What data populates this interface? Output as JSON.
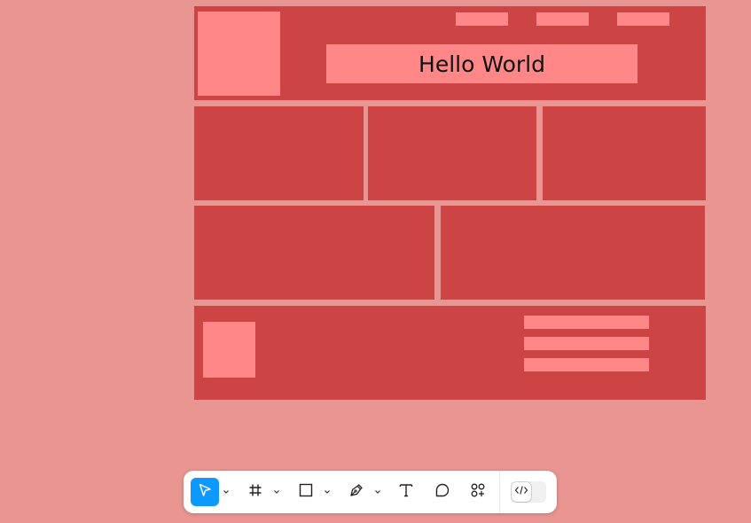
{
  "canvas": {
    "background": "#e99591",
    "block_color": "#cc4444",
    "accent_color": "#ff8787"
  },
  "header": {
    "title": "Hello World"
  },
  "toolbar": {
    "active_color": "#0d99ff",
    "tools": [
      {
        "name": "move-tool",
        "icon": "cursor-arrow-icon",
        "active": true,
        "has_menu": true
      },
      {
        "name": "frame-tool",
        "icon": "frame-hash-icon",
        "active": false,
        "has_menu": true
      },
      {
        "name": "shape-tool",
        "icon": "rectangle-icon",
        "active": false,
        "has_menu": true
      },
      {
        "name": "pen-tool",
        "icon": "pen-nib-icon",
        "active": false,
        "has_menu": true
      },
      {
        "name": "text-tool",
        "icon": "text-t-icon",
        "active": false,
        "has_menu": false
      },
      {
        "name": "comment-tool",
        "icon": "speech-bubble-icon",
        "active": false,
        "has_menu": false
      },
      {
        "name": "resources-tool",
        "icon": "components-grid-plus-icon",
        "active": false,
        "has_menu": false
      }
    ],
    "dev_mode": {
      "icon": "code-brackets-icon",
      "on": false
    }
  }
}
